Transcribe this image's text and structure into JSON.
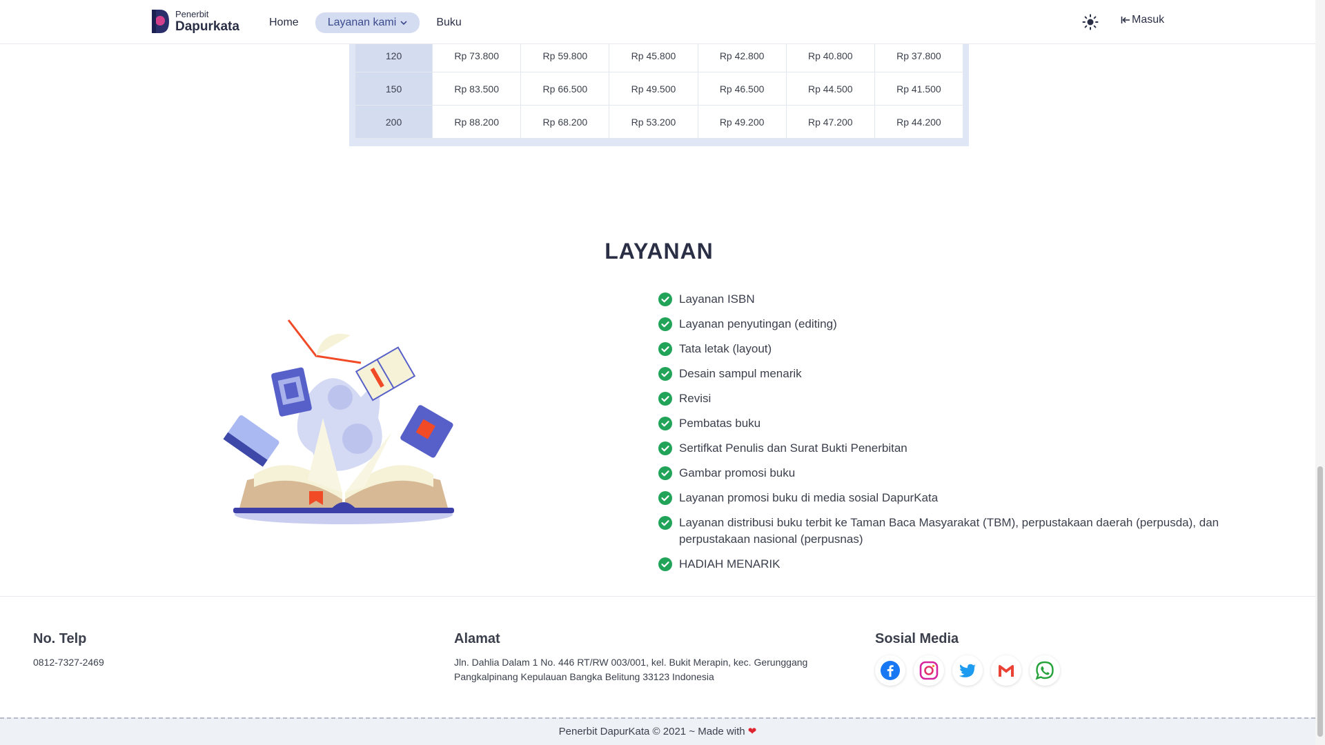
{
  "nav": {
    "brand_small": "Penerbit",
    "brand_big": "Dapurkata",
    "links": [
      "Home",
      "Layanan kami",
      "Buku"
    ],
    "login_label": "Masuk",
    "accent": "#d4dcf2"
  },
  "price_table": {
    "rows": [
      {
        "pages": "120",
        "prices": [
          "Rp 73.800",
          "Rp 59.800",
          "Rp 45.800",
          "Rp 42.800",
          "Rp 40.800",
          "Rp 37.800"
        ]
      },
      {
        "pages": "150",
        "prices": [
          "Rp 83.500",
          "Rp 66.500",
          "Rp 49.500",
          "Rp 46.500",
          "Rp 44.500",
          "Rp 41.500"
        ]
      },
      {
        "pages": "200",
        "prices": [
          "Rp 88.200",
          "Rp 68.200",
          "Rp 53.200",
          "Rp 49.200",
          "Rp 47.200",
          "Rp 44.200"
        ]
      }
    ]
  },
  "services": {
    "title": "LAYANAN",
    "items": [
      "Layanan ISBN",
      "Layanan penyutingan (editing)",
      "Tata letak (layout)",
      "Desain sampul menarik",
      "Revisi",
      "Pembatas buku",
      "Sertifkat Penulis dan Surat Bukti Penerbitan",
      "Gambar promosi buku",
      "Layanan promosi buku di media sosial DapurKata",
      "Layanan distribusi buku terbit ke Taman Baca Masyarakat (TBM), perpustakaan daerah (perpusda), dan perpustakaan nasional (perpusnas)",
      "HADIAH MENARIK"
    ],
    "check_color": "#22a35a"
  },
  "footer": {
    "phone_title": "No. Telp",
    "phone": "0812-7327-2469",
    "address_title": "Alamat",
    "address": "Jln. Dahlia Dalam 1 No. 446 RT/RW 003/001, kel. Bukit Merapin, kec. Gerunggang Pangkalpinang Kepulauan Bangka Belitung 33123 Indonesia",
    "social_title": "Sosial Media",
    "social_icons": [
      "facebook-icon",
      "instagram-icon",
      "twitter-icon",
      "gmail-icon",
      "whatsapp-icon"
    ],
    "copyright": "Penerbit DapurKata © 2021 ~ Made with",
    "heart": "❤"
  }
}
